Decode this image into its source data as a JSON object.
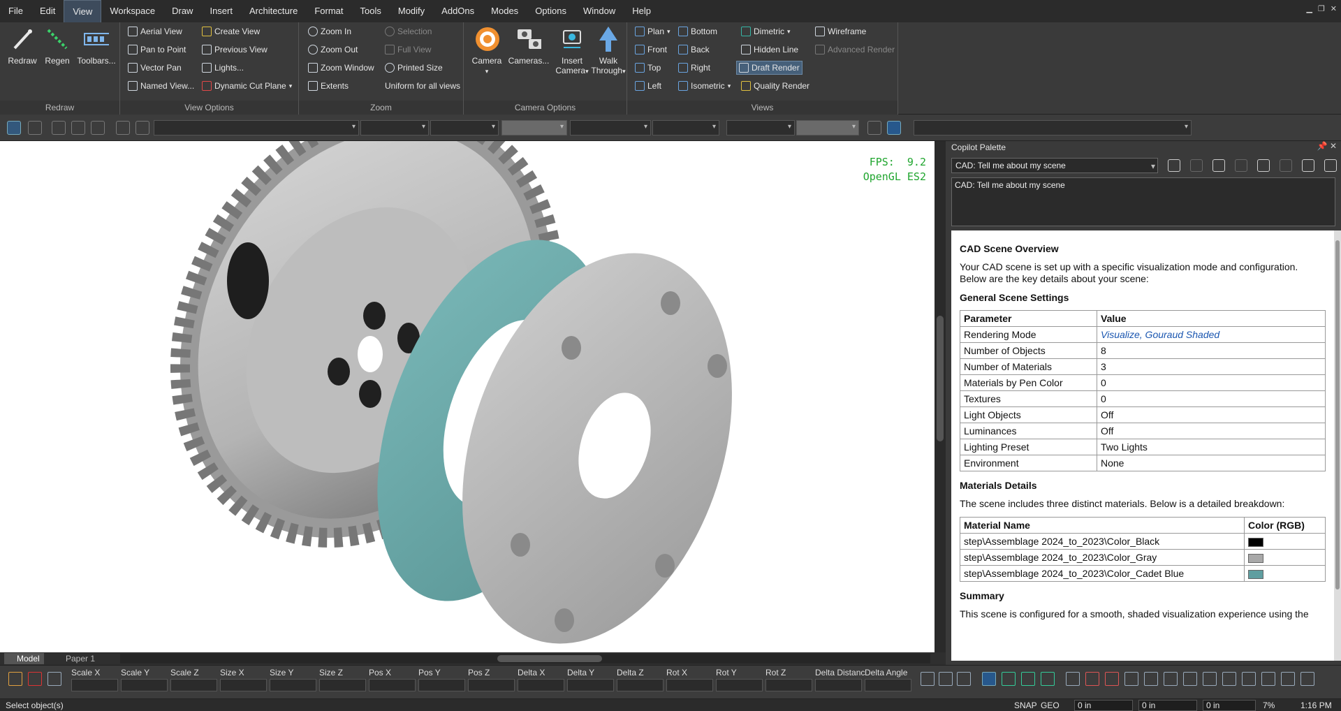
{
  "menu": [
    "File",
    "Edit",
    "View",
    "Workspace",
    "Draw",
    "Insert",
    "Architecture",
    "Format",
    "Tools",
    "Modify",
    "AddOns",
    "Modes",
    "Options",
    "Window",
    "Help"
  ],
  "ribbon": {
    "redraw": {
      "title": "Redraw",
      "buttons": [
        "Redraw",
        "Regen",
        "Toolbars..."
      ]
    },
    "view_options": {
      "title": "View Options",
      "items": [
        "Aerial View",
        "Pan to Point",
        "Vector Pan",
        "Named View...",
        "Create View",
        "Previous View",
        "Lights...",
        "Dynamic Cut Plane"
      ]
    },
    "zoom": {
      "title": "Zoom",
      "items": [
        "Zoom In",
        "Zoom Out",
        "Zoom Window",
        "Extents",
        "Selection",
        "Full View",
        "Printed Size",
        "Uniform for all views"
      ]
    },
    "camera_options": {
      "title": "Camera Options",
      "buttons": [
        "Camera",
        "Cameras...",
        "Insert Camera",
        "Walk Through"
      ]
    },
    "views": {
      "title": "Views",
      "items": [
        "Plan",
        "Front",
        "Top",
        "Left",
        "Bottom",
        "Back",
        "Right",
        "Isometric",
        "Dimetric",
        "Hidden Line",
        "Draft Render",
        "Quality Render",
        "Wireframe",
        "Advanced Render"
      ]
    }
  },
  "viewport": {
    "fps_label": "FPS:",
    "fps_value": "9.2",
    "renderer": "OpenGL ES2"
  },
  "tabs": {
    "model": "Model",
    "paper": "Paper 1"
  },
  "palette": {
    "title": "Copilot Palette",
    "combo_value": "CAD: Tell me about my scene",
    "prompt_text": "CAD: Tell me about my scene",
    "overview_heading": "CAD Scene Overview",
    "overview_text": "Your CAD scene is set up with a specific visualization mode and configuration. Below are the key details about your scene:",
    "general_heading": "General Scene Settings",
    "general_table": {
      "headers": [
        "Parameter",
        "Value"
      ],
      "rows": [
        [
          "Rendering Mode",
          "Visualize, Gouraud Shaded"
        ],
        [
          "Number of Objects",
          "8"
        ],
        [
          "Number of Materials",
          "3"
        ],
        [
          "Materials by Pen Color",
          "0"
        ],
        [
          "Textures",
          "0"
        ],
        [
          "Light Objects",
          "Off"
        ],
        [
          "Luminances",
          "Off"
        ],
        [
          "Lighting Preset",
          "Two Lights"
        ],
        [
          "Environment",
          "None"
        ]
      ]
    },
    "materials_heading": "Materials Details",
    "materials_text": "The scene includes three distinct materials. Below is a detailed breakdown:",
    "materials_table": {
      "headers": [
        "Material Name",
        "Color (RGB)"
      ],
      "rows": [
        {
          "name": "step\\Assemblage 2024_to_2023\\Color_Black",
          "color": "#000000"
        },
        {
          "name": "step\\Assemblage 2024_to_2023\\Color_Gray",
          "color": "#a8a8a8"
        },
        {
          "name": "step\\Assemblage 2024_to_2023\\Color_Cadet Blue",
          "color": "#5f9ea0"
        }
      ]
    },
    "summary_heading": "Summary",
    "summary_text": "This scene is configured for a smooth, shaded visualization experience using the"
  },
  "transform_fields": [
    "Scale X",
    "Scale Y",
    "Scale Z",
    "Size X",
    "Size Y",
    "Size Z",
    "Pos X",
    "Pos Y",
    "Pos Z",
    "Delta X",
    "Delta Y",
    "Delta Z",
    "Rot X",
    "Rot Y",
    "Rot Z",
    "Delta Distanc",
    "Delta Angle"
  ],
  "status": {
    "message": "Select object(s)",
    "snap": "SNAP",
    "geo": "GEO",
    "x": "0 in",
    "y": "0 in",
    "z": "0 in",
    "zoom": "7%",
    "time": "1:16 PM"
  }
}
